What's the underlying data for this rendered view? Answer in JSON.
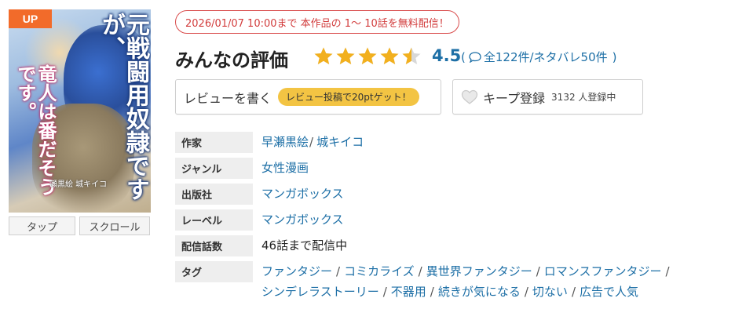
{
  "cover": {
    "badge": "UP",
    "title_main": "元戦闘用奴隷ですが、",
    "title_sub": "竜人は番だそうです。",
    "author_line": "瀬黒絵 城キイコ"
  },
  "view_buttons": [
    "タップ",
    "スクロール"
  ],
  "free_notice": "2026/01/07 10:00まで 本作品の 1～ 10話を無料配信！",
  "rating": {
    "title": "みんなの評価",
    "score": "4.5",
    "stars_value": 4.5,
    "count_prefix": "(",
    "count_text": "全122件/ネタバレ50件",
    "count_suffix": ")"
  },
  "review_button": {
    "label": "レビューを書く",
    "bonus": "レビュー投稿で20ptゲット！"
  },
  "keep_button": {
    "label": "キープ登録",
    "count": "3132 人登録中"
  },
  "meta": {
    "author_key": "作家",
    "authors": [
      "早瀬黒絵",
      "城キイコ"
    ],
    "genre_key": "ジャンル",
    "genre": "女性漫画",
    "publisher_key": "出版社",
    "publisher": "マンガボックス",
    "label_key": "レーベル",
    "label": "マンガボックス",
    "episodes_key": "配信話数",
    "episodes": "46話まで配信中",
    "tags_key": "タグ",
    "tags": [
      "ファンタジー",
      "コミカライズ",
      "異世界ファンタジー",
      "ロマンスファンタジー",
      "シンデレラストーリー",
      "不器用",
      "続きが気になる",
      "切ない",
      "広告で人気"
    ]
  },
  "colors": {
    "accent_blue": "#1d6fa6",
    "star_gold": "#f2b01e",
    "notice_red": "#d23c3c",
    "badge_orange": "#f26b2a",
    "pill_yellow": "#f3c443"
  }
}
